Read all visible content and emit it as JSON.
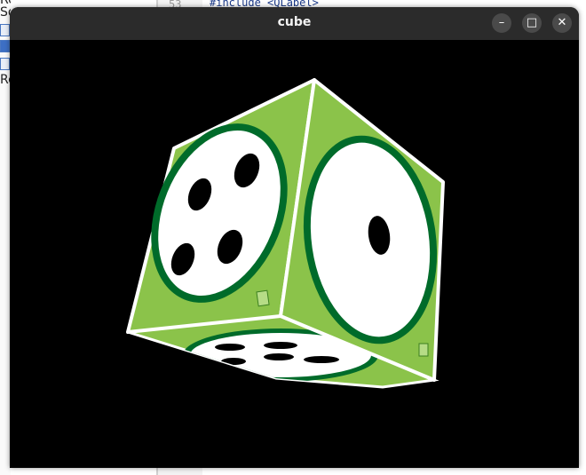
{
  "window": {
    "title": "cube",
    "controls": {
      "minimize": "–",
      "maximize": "□",
      "close": "✕"
    }
  },
  "background_ide": {
    "left_panel_texts": [
      "Resource",
      "So",
      "Re"
    ],
    "line_number": "53",
    "code_line": "#include <QLabel>"
  },
  "scene": {
    "object": "dice-cube",
    "colors": {
      "face_green": "#8bc34a",
      "ring_green": "#006b2a",
      "dot_black": "#000000",
      "face_white": "#ffffff",
      "background": "#000000"
    },
    "faces": {
      "left": {
        "pips": 4
      },
      "right": {
        "pips": 1
      },
      "bottom": {
        "pips": 5
      }
    }
  }
}
